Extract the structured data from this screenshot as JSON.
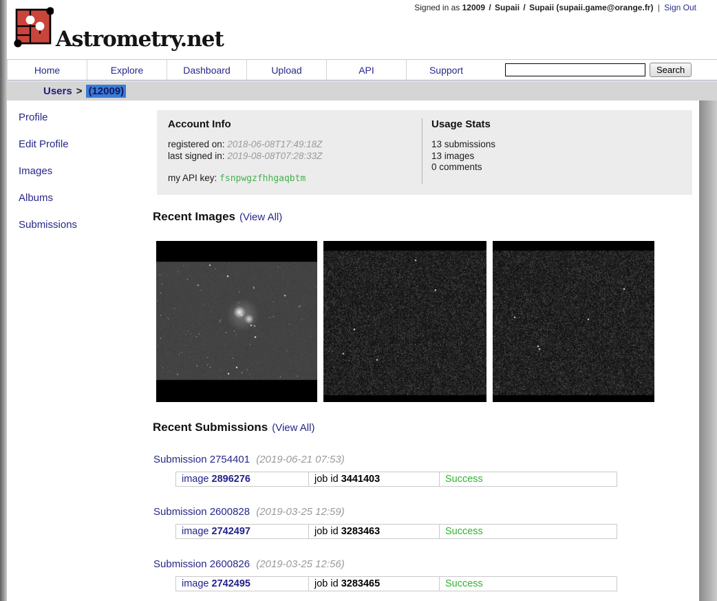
{
  "colors": {
    "link_navy": "#27278a",
    "success_green": "#2fb32f",
    "api_key_green": "#44b04e",
    "date_gray": "#9a9a9a",
    "selection_blue": "#3c7ad6",
    "logo_red": "#c9453c",
    "crumb_bar_gray": "#d5d5d5",
    "account_box_gray": "#ececec"
  },
  "header": {
    "logo_text": "Astrometry.net",
    "signin": {
      "prefix": "Signed in as",
      "user_id": "12009",
      "separator": "/",
      "username": "Supaii",
      "account": "Supaii (supaii.game@orange.fr)",
      "pipe": "|",
      "sign_out_label": "Sign Out"
    }
  },
  "nav": {
    "items": [
      "Home",
      "Explore",
      "Dashboard",
      "Upload",
      "API",
      "Support"
    ],
    "search": {
      "value": "",
      "button_label": "Search"
    }
  },
  "breadcrumb": {
    "root": "Users",
    "separator": ">",
    "current": "(12009)"
  },
  "sidebar": {
    "items": [
      "Profile",
      "Edit Profile",
      "Images",
      "Albums",
      "Submissions"
    ]
  },
  "account_info": {
    "title": "Account Info",
    "registered_label": "registered on:",
    "registered_value": "2018-06-08T17:49:18Z",
    "last_signed_label": "last signed in:",
    "last_signed_value": "2019-08-08T07:28:33Z",
    "api_key_label": "my API key:",
    "api_key_value": "fsnpwgzfhhgaqbtm"
  },
  "usage_stats": {
    "title": "Usage Stats",
    "lines": [
      "13 submissions",
      "13 images",
      "0 comments"
    ]
  },
  "recent_images": {
    "title": "Recent Images",
    "view_all_label": "(View All)"
  },
  "recent_submissions": {
    "title": "Recent Submissions",
    "view_all_label": "(View All)",
    "items": [
      {
        "link": "Submission 2754401",
        "date": "(2019-06-21 07:53)",
        "image_label": "image",
        "image_id": "2896276",
        "job_label": "job id",
        "job_id": "3441403",
        "status": "Success"
      },
      {
        "link": "Submission 2600828",
        "date": "(2019-03-25 12:59)",
        "image_label": "image",
        "image_id": "2742497",
        "job_label": "job id",
        "job_id": "3283463",
        "status": "Success"
      },
      {
        "link": "Submission 2600826",
        "date": "(2019-03-25 12:56)",
        "image_label": "image",
        "image_id": "2742495",
        "job_label": "job id",
        "job_id": "3283465",
        "status": "Success"
      }
    ]
  }
}
